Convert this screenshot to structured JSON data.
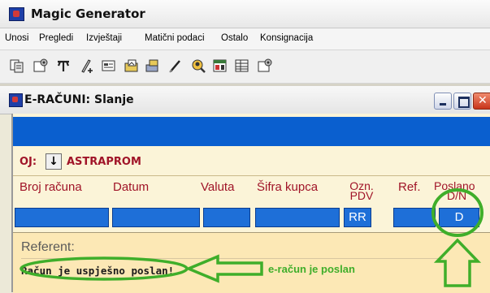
{
  "app": {
    "title": "Magic Generator"
  },
  "menu": {
    "items": [
      "Unosi",
      "Pregledi",
      "Izvještaji",
      "Matični podaci",
      "Ostalo",
      "Konsignacija"
    ]
  },
  "toolbar": {
    "icons": [
      "copy-icon",
      "settings-icon",
      "tools-icon",
      "edit-plus-icon",
      "form-icon",
      "folder-image-icon",
      "transfer-icon",
      "pen-icon",
      "search-user-icon",
      "grid-icon",
      "table-icon",
      "settings-window-icon"
    ]
  },
  "window": {
    "title": "E-RAČUNI: Slanje"
  },
  "oj": {
    "label": "OJ:",
    "button_glyph": "↓",
    "value": "ASTRAPROM"
  },
  "columns": {
    "broj_racuna": "Broj računa",
    "datum": "Datum",
    "valuta": "Valuta",
    "sifra_kupca": "Šifra kupca",
    "ozn_pdv": [
      "Ozn.",
      "PDV"
    ],
    "ref": "Ref.",
    "poslano": [
      "Poslano",
      "D/N"
    ]
  },
  "row": {
    "ozn_pdv": "RR",
    "poslano": "D"
  },
  "panel": {
    "referent_label": "Referent:",
    "status_message": "Račun je uspješno poslan!"
  },
  "annotation": {
    "text": "e-račun je poslan",
    "color": "#3fae2a"
  },
  "colors": {
    "band_blue": "#0a5fcf",
    "cell_blue": "#1e6fd8",
    "label_red": "#a01428",
    "panel_bg": "#fce8b5"
  }
}
